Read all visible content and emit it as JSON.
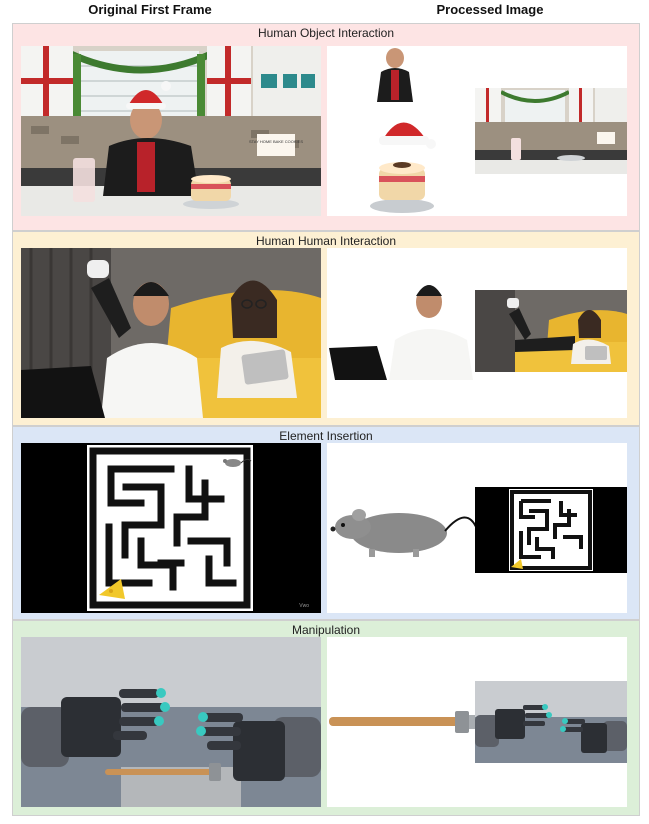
{
  "headers": {
    "left": "Original First Frame",
    "right": "Processed Image"
  },
  "sections": [
    {
      "title": "Human Object Interaction",
      "bg": "#fde4e4"
    },
    {
      "title": "Human Human Interaction",
      "bg": "#fdf0d3"
    },
    {
      "title": "Element Insertion",
      "bg": "#dbe6f6"
    },
    {
      "title": "Manipulation",
      "bg": "#dcefd8"
    }
  ],
  "kitchen_sign": "STAY HOME BAKE COOKIES",
  "watermark": "Vwo"
}
